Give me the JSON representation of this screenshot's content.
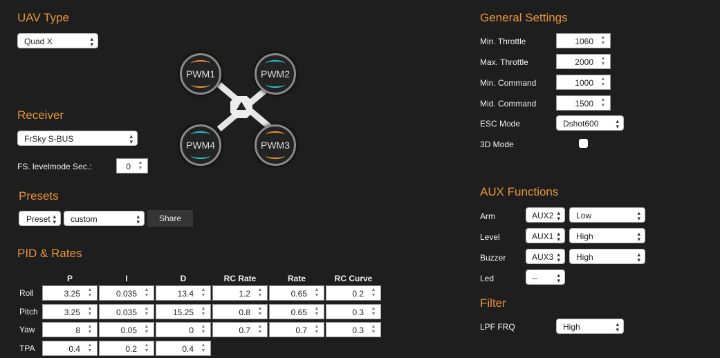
{
  "uav_type": {
    "title": "UAV Type",
    "selected": "Quad X"
  },
  "motors": [
    {
      "label": "PWM1",
      "rotation": "orange"
    },
    {
      "label": "PWM2",
      "rotation": "cyan"
    },
    {
      "label": "PWM3",
      "rotation": "orange"
    },
    {
      "label": "PWM4",
      "rotation": "cyan"
    }
  ],
  "receiver": {
    "title": "Receiver",
    "selected": "FrSky S-BUS",
    "fs_label": "FS. levelmode Sec.:",
    "fs_value": "0"
  },
  "presets": {
    "title": "Presets",
    "preset_select": "Preset",
    "preset_value": "custom",
    "share_label": "Share"
  },
  "pid": {
    "title": "PID & Rates",
    "columns": [
      "P",
      "I",
      "D",
      "RC Rate",
      "Rate",
      "RC Curve"
    ],
    "rows": [
      {
        "label": "Roll",
        "values": [
          "3.25",
          "0.035",
          "13.4",
          "1.2",
          "0.65",
          "0.2"
        ]
      },
      {
        "label": "Pitch",
        "values": [
          "3.25",
          "0.035",
          "15.25",
          "0.8",
          "0.65",
          "0.3"
        ]
      },
      {
        "label": "Yaw",
        "values": [
          "8",
          "0.05",
          "0",
          "0.7",
          "0.7",
          "0.3"
        ]
      },
      {
        "label": "TPA",
        "values": [
          "0.4",
          "0.2",
          "0.4"
        ]
      }
    ]
  },
  "general": {
    "title": "General Settings",
    "fields": [
      {
        "label": "Min. Throttle",
        "value": "1060"
      },
      {
        "label": "Max. Throttle",
        "value": "2000"
      },
      {
        "label": "Min. Command",
        "value": "1000"
      },
      {
        "label": "Mid. Command",
        "value": "1500"
      }
    ],
    "esc_label": "ESC Mode",
    "esc_value": "Dshot600",
    "mode3d_label": "3D Mode",
    "mode3d_checked": false
  },
  "aux": {
    "title": "AUX Functions",
    "rows": [
      {
        "label": "Arm",
        "channel": "AUX2",
        "level": "Low"
      },
      {
        "label": "Level",
        "channel": "AUX1",
        "level": "High"
      },
      {
        "label": "Buzzer",
        "channel": "AUX3",
        "level": "High"
      },
      {
        "label": "Led",
        "channel": "--",
        "level": null
      }
    ]
  },
  "filter": {
    "title": "Filter",
    "lpf_label": "LPF FRQ",
    "lpf_value": "High"
  },
  "colors": {
    "accent": "#e8953a",
    "cw": "#e8953a",
    "ccw": "#2ec4d4",
    "background": "#1e1e1e"
  }
}
